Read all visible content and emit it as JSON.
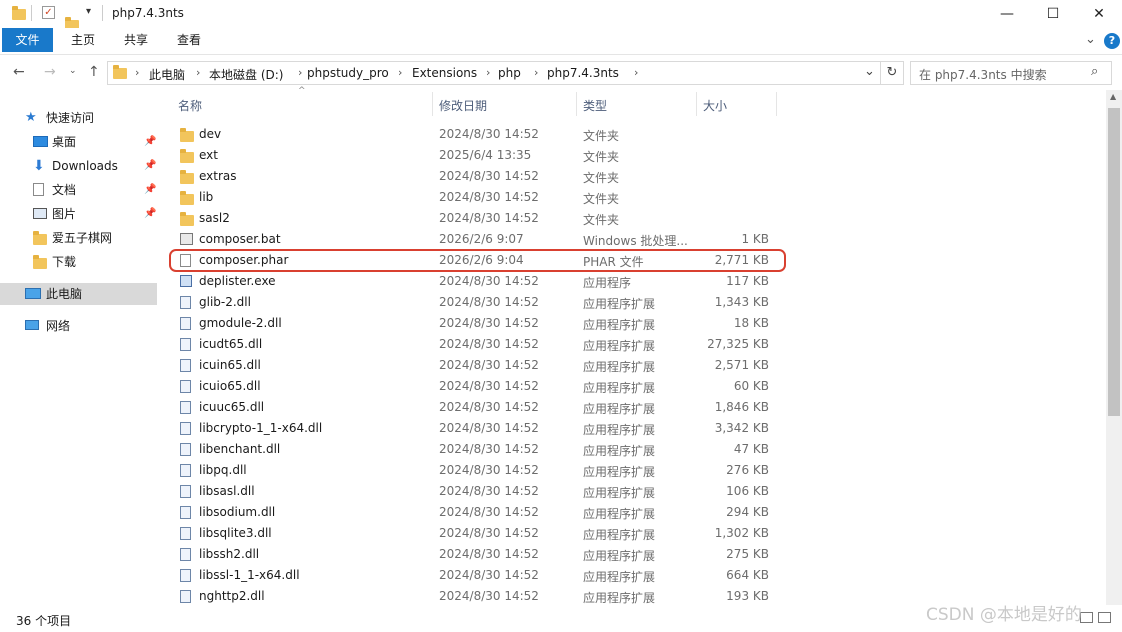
{
  "window": {
    "title": "php7.4.3nts",
    "minimize": "—",
    "maximize": "☐",
    "close": "✕"
  },
  "ribbon": {
    "tabs": [
      "文件",
      "主页",
      "共享",
      "查看"
    ],
    "collapse": "⌄",
    "help": "?"
  },
  "address": {
    "crumbs": [
      "此电脑",
      "本地磁盘 (D:)",
      "phpstudy_pro",
      "Extensions",
      "php",
      "php7.4.3nts"
    ],
    "dropdown": "⌄",
    "refresh": "↻"
  },
  "search": {
    "placeholder": "在 php7.4.3nts 中搜索"
  },
  "nav": {
    "quick_access": "快速访问",
    "items": [
      "桌面",
      "Downloads",
      "文档",
      "图片",
      "爱五子棋网",
      "下载"
    ],
    "this_pc": "此电脑",
    "network": "网络"
  },
  "columns": {
    "name": "名称",
    "date": "修改日期",
    "type": "类型",
    "size": "大小"
  },
  "files": [
    {
      "name": "dev",
      "date": "2024/8/30 14:52",
      "type": "文件夹",
      "size": "",
      "icon": "folder"
    },
    {
      "name": "ext",
      "date": "2025/6/4 13:35",
      "type": "文件夹",
      "size": "",
      "icon": "folder"
    },
    {
      "name": "extras",
      "date": "2024/8/30 14:52",
      "type": "文件夹",
      "size": "",
      "icon": "folder"
    },
    {
      "name": "lib",
      "date": "2024/8/30 14:52",
      "type": "文件夹",
      "size": "",
      "icon": "folder"
    },
    {
      "name": "sasl2",
      "date": "2024/8/30 14:52",
      "type": "文件夹",
      "size": "",
      "icon": "folder"
    },
    {
      "name": "composer.bat",
      "date": "2026/2/6 9:07",
      "type": "Windows 批处理...",
      "size": "1 KB",
      "icon": "bat"
    },
    {
      "name": "composer.phar",
      "date": "2026/2/6 9:04",
      "type": "PHAR 文件",
      "size": "2,771 KB",
      "icon": "doc"
    },
    {
      "name": "deplister.exe",
      "date": "2024/8/30 14:52",
      "type": "应用程序",
      "size": "117 KB",
      "icon": "exe"
    },
    {
      "name": "glib-2.dll",
      "date": "2024/8/30 14:52",
      "type": "应用程序扩展",
      "size": "1,343 KB",
      "icon": "dll"
    },
    {
      "name": "gmodule-2.dll",
      "date": "2024/8/30 14:52",
      "type": "应用程序扩展",
      "size": "18 KB",
      "icon": "dll"
    },
    {
      "name": "icudt65.dll",
      "date": "2024/8/30 14:52",
      "type": "应用程序扩展",
      "size": "27,325 KB",
      "icon": "dll"
    },
    {
      "name": "icuin65.dll",
      "date": "2024/8/30 14:52",
      "type": "应用程序扩展",
      "size": "2,571 KB",
      "icon": "dll"
    },
    {
      "name": "icuio65.dll",
      "date": "2024/8/30 14:52",
      "type": "应用程序扩展",
      "size": "60 KB",
      "icon": "dll"
    },
    {
      "name": "icuuc65.dll",
      "date": "2024/8/30 14:52",
      "type": "应用程序扩展",
      "size": "1,846 KB",
      "icon": "dll"
    },
    {
      "name": "libcrypto-1_1-x64.dll",
      "date": "2024/8/30 14:52",
      "type": "应用程序扩展",
      "size": "3,342 KB",
      "icon": "dll"
    },
    {
      "name": "libenchant.dll",
      "date": "2024/8/30 14:52",
      "type": "应用程序扩展",
      "size": "47 KB",
      "icon": "dll"
    },
    {
      "name": "libpq.dll",
      "date": "2024/8/30 14:52",
      "type": "应用程序扩展",
      "size": "276 KB",
      "icon": "dll"
    },
    {
      "name": "libsasl.dll",
      "date": "2024/8/30 14:52",
      "type": "应用程序扩展",
      "size": "106 KB",
      "icon": "dll"
    },
    {
      "name": "libsodium.dll",
      "date": "2024/8/30 14:52",
      "type": "应用程序扩展",
      "size": "294 KB",
      "icon": "dll"
    },
    {
      "name": "libsqlite3.dll",
      "date": "2024/8/30 14:52",
      "type": "应用程序扩展",
      "size": "1,302 KB",
      "icon": "dll"
    },
    {
      "name": "libssh2.dll",
      "date": "2024/8/30 14:52",
      "type": "应用程序扩展",
      "size": "275 KB",
      "icon": "dll"
    },
    {
      "name": "libssl-1_1-x64.dll",
      "date": "2024/8/30 14:52",
      "type": "应用程序扩展",
      "size": "664 KB",
      "icon": "dll"
    },
    {
      "name": "nghttp2.dll",
      "date": "2024/8/30 14:52",
      "type": "应用程序扩展",
      "size": "193 KB",
      "icon": "dll"
    }
  ],
  "status": {
    "count": "36 个项目"
  },
  "watermark": "CSDN @本地是好的",
  "colors": {
    "accent": "#1979ca",
    "highlight": "#d94030",
    "folder": "#f2c55c"
  }
}
